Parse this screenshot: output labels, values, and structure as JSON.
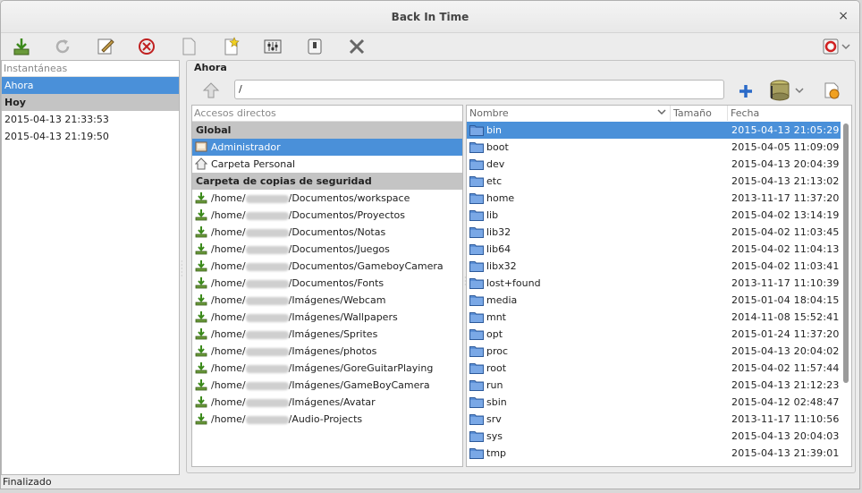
{
  "window": {
    "title": "Back In Time",
    "close_glyph": "×"
  },
  "toolbar": {
    "icons": [
      "take-snapshot-icon",
      "refresh-icon",
      "edit-name-icon",
      "remove-snapshot-icon",
      "view-log-icon",
      "view-last-log-icon",
      "settings-icon",
      "shutdown-icon",
      "exit-icon",
      "help-icon"
    ]
  },
  "snapshots": {
    "header": "Instantáneas",
    "now": "Ahora",
    "group_today": "Hoy",
    "items": [
      "2015-04-13 21:33:53",
      "2015-04-13 21:19:50"
    ]
  },
  "status": "Finalizado",
  "browser": {
    "frame_label": "Ahora",
    "path": "/",
    "places_header": "Accesos directos",
    "global_label": "Global",
    "global_items": [
      {
        "label": "Administrador",
        "icon": "root-icon",
        "selected": true
      },
      {
        "label": "Carpeta Personal",
        "icon": "home-icon",
        "selected": false
      }
    ],
    "backup_label": "Carpeta de copias de seguridad",
    "backup_items": [
      {
        "prefix": "/home/",
        "suffix": "/Documentos/workspace"
      },
      {
        "prefix": "/home/",
        "suffix": "/Documentos/Proyectos"
      },
      {
        "prefix": "/home/",
        "suffix": "/Documentos/Notas"
      },
      {
        "prefix": "/home/",
        "suffix": "/Documentos/Juegos"
      },
      {
        "prefix": "/home/",
        "suffix": "/Documentos/GameboyCamera"
      },
      {
        "prefix": "/home/",
        "suffix": "/Documentos/Fonts"
      },
      {
        "prefix": "/home/",
        "suffix": "/Imágenes/Webcam"
      },
      {
        "prefix": "/home/",
        "suffix": "/Imágenes/Wallpapers"
      },
      {
        "prefix": "/home/",
        "suffix": "/Imágenes/Sprites"
      },
      {
        "prefix": "/home/",
        "suffix": "/Imágenes/photos"
      },
      {
        "prefix": "/home/",
        "suffix": "/Imágenes/GoreGuitarPlaying"
      },
      {
        "prefix": "/home/",
        "suffix": "/Imágenes/GameBoyCamera"
      },
      {
        "prefix": "/home/",
        "suffix": "/Imágenes/Avatar"
      },
      {
        "prefix": "/home/",
        "suffix": "/Audio-Projects"
      }
    ],
    "columns": {
      "name": "Nombre",
      "size": "Tamaño",
      "date": "Fecha"
    },
    "files": [
      {
        "name": "bin",
        "date": "2015-04-13 21:05:29",
        "selected": true
      },
      {
        "name": "boot",
        "date": "2015-04-05 11:09:09"
      },
      {
        "name": "dev",
        "date": "2015-04-13 20:04:39"
      },
      {
        "name": "etc",
        "date": "2015-04-13 21:13:02"
      },
      {
        "name": "home",
        "date": "2013-11-17 11:37:20"
      },
      {
        "name": "lib",
        "date": "2015-04-02 13:14:19"
      },
      {
        "name": "lib32",
        "date": "2015-04-02 11:03:45"
      },
      {
        "name": "lib64",
        "date": "2015-04-02 11:04:13"
      },
      {
        "name": "libx32",
        "date": "2015-04-02 11:03:41"
      },
      {
        "name": "lost+found",
        "date": "2013-11-17 11:10:39"
      },
      {
        "name": "media",
        "date": "2015-01-04 18:04:15"
      },
      {
        "name": "mnt",
        "date": "2014-11-08 15:52:41"
      },
      {
        "name": "opt",
        "date": "2015-01-24 11:37:20"
      },
      {
        "name": "proc",
        "date": "2015-04-13 20:04:02"
      },
      {
        "name": "root",
        "date": "2015-04-02 11:57:44"
      },
      {
        "name": "run",
        "date": "2015-04-13 21:12:23"
      },
      {
        "name": "sbin",
        "date": "2015-04-12 02:48:47"
      },
      {
        "name": "srv",
        "date": "2013-11-17 11:10:56"
      },
      {
        "name": "sys",
        "date": "2015-04-13 20:04:03"
      },
      {
        "name": "tmp",
        "date": "2015-04-13 21:39:01"
      }
    ]
  },
  "colors": {
    "selection": "#4a90d9",
    "group_bg": "#c4c4c4",
    "folder": "#5b8fd6"
  }
}
